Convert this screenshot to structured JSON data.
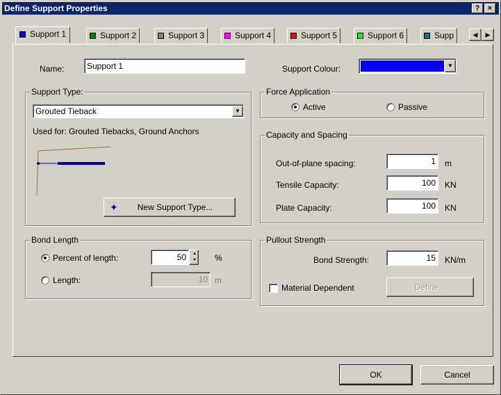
{
  "window": {
    "title": "Define Support Properties",
    "help_icon": "?",
    "close_icon": "×"
  },
  "tabs": [
    {
      "label": "Support 1",
      "color": "#0000ff"
    },
    {
      "label": "Support 2",
      "color": "#008000"
    },
    {
      "label": "Support 3",
      "color": "#808080"
    },
    {
      "label": "Support 4",
      "color": "#ff00ff"
    },
    {
      "label": "Support 5",
      "color": "#ff0000"
    },
    {
      "label": "Support 6",
      "color": "#00ff00"
    },
    {
      "label": "Supp",
      "color": "#008080"
    }
  ],
  "tab_scroll": {
    "left_icon": "◀",
    "right_icon": "▶"
  },
  "name": {
    "label": "Name:",
    "value": "Support 1"
  },
  "support_colour": {
    "label": "Support Colour:",
    "value": "#0000ff"
  },
  "support_type": {
    "group_title": "Support Type:",
    "selected": "Grouted Tieback",
    "used_for": "Used for: Grouted Tiebacks, Ground Anchors",
    "new_button": "New Support Type..."
  },
  "force_application": {
    "group_title": "Force Application",
    "options": [
      {
        "label": "Active",
        "checked": true
      },
      {
        "label": "Passive",
        "checked": false
      }
    ]
  },
  "capacity_spacing": {
    "group_title": "Capacity and Spacing",
    "rows": [
      {
        "label": "Out-of-plane spacing:",
        "value": "1",
        "unit": "m"
      },
      {
        "label": "Tensile Capacity:",
        "value": "100",
        "unit": "KN"
      },
      {
        "label": "Plate Capacity:",
        "value": "100",
        "unit": "KN"
      }
    ]
  },
  "bond_length": {
    "group_title": "Bond Length",
    "percent_label": "Percent of length:",
    "percent_value": "50",
    "percent_unit": "%",
    "percent_checked": true,
    "length_label": "Length:",
    "length_value": "10",
    "length_unit": "m",
    "length_checked": false
  },
  "pullout": {
    "group_title": "Pullout Strength",
    "bond_label": "Bond Strength:",
    "bond_value": "15",
    "bond_unit": "KN/m",
    "material_dependent_label": "Material Dependent",
    "material_dependent_checked": false,
    "define_button": "Define..."
  },
  "buttons": {
    "ok": "OK",
    "cancel": "Cancel"
  }
}
